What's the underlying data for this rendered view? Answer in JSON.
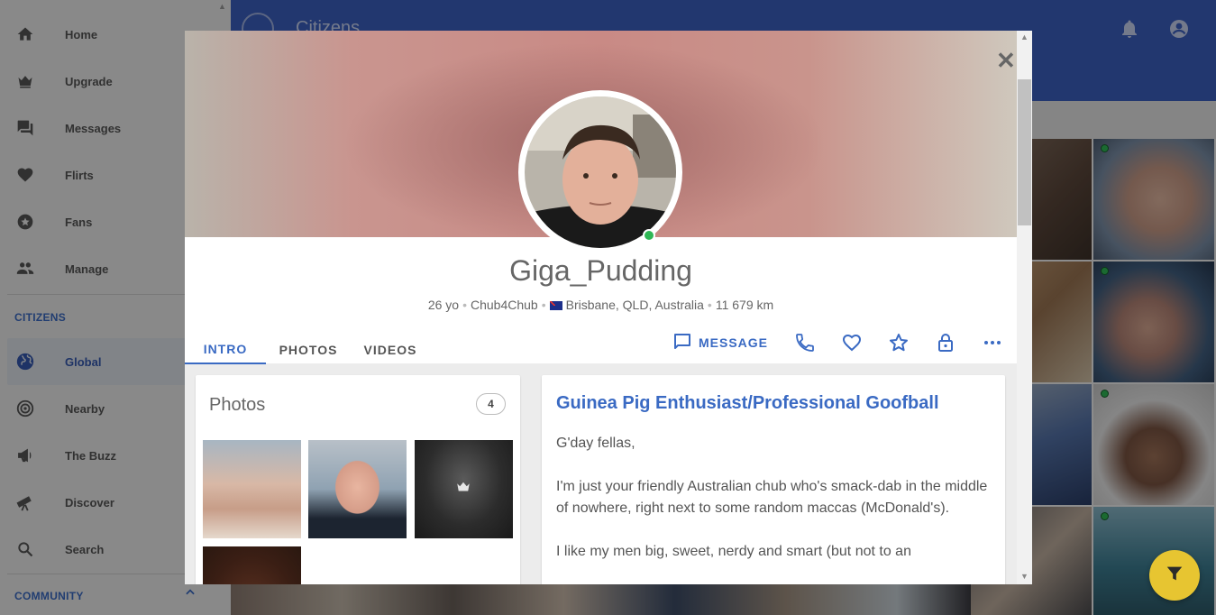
{
  "sidebar": {
    "items": [
      {
        "label": "Home",
        "icon": "home-icon"
      },
      {
        "label": "Upgrade",
        "icon": "crown-icon"
      },
      {
        "label": "Messages",
        "icon": "messages-icon"
      },
      {
        "label": "Flirts",
        "icon": "heart-icon"
      },
      {
        "label": "Fans",
        "icon": "star-circle-icon"
      },
      {
        "label": "Manage",
        "icon": "people-icon"
      }
    ],
    "citizens_title": "CITIZENS",
    "citizens_items": [
      {
        "label": "Global",
        "icon": "globe-icon",
        "active": true
      },
      {
        "label": "Nearby",
        "icon": "radar-icon"
      },
      {
        "label": "The Buzz",
        "icon": "megaphone-icon"
      },
      {
        "label": "Discover",
        "icon": "telescope-icon"
      },
      {
        "label": "Search",
        "icon": "search-icon"
      }
    ],
    "community_title": "COMMUNITY"
  },
  "header": {
    "title": "Citizens"
  },
  "profile": {
    "username": "Giga_Pudding",
    "age": "26 yo",
    "community": "Chub4Chub",
    "location": "Brisbane, QLD, Australia",
    "distance": "11 679 km",
    "online": true
  },
  "tabs": [
    "INTRO",
    "PHOTOS",
    "VIDEOS"
  ],
  "actions": {
    "message_label": "MESSAGE"
  },
  "photos": {
    "title": "Photos",
    "count": "4"
  },
  "about": {
    "headline": "Guinea Pig Enthusiast/Professional Goofball",
    "paragraphs": [
      "G'day fellas,",
      "I'm just your friendly Australian chub who's smack-dab in the middle of nowhere, right next to some random maccas (McDonald's).",
      "I like my men big, sweet, nerdy and smart (but not to an"
    ]
  },
  "colors": {
    "brand": "#3b5fc0",
    "accent": "#3a6ac3",
    "online": "#2fb755",
    "fab": "#e7c531"
  }
}
